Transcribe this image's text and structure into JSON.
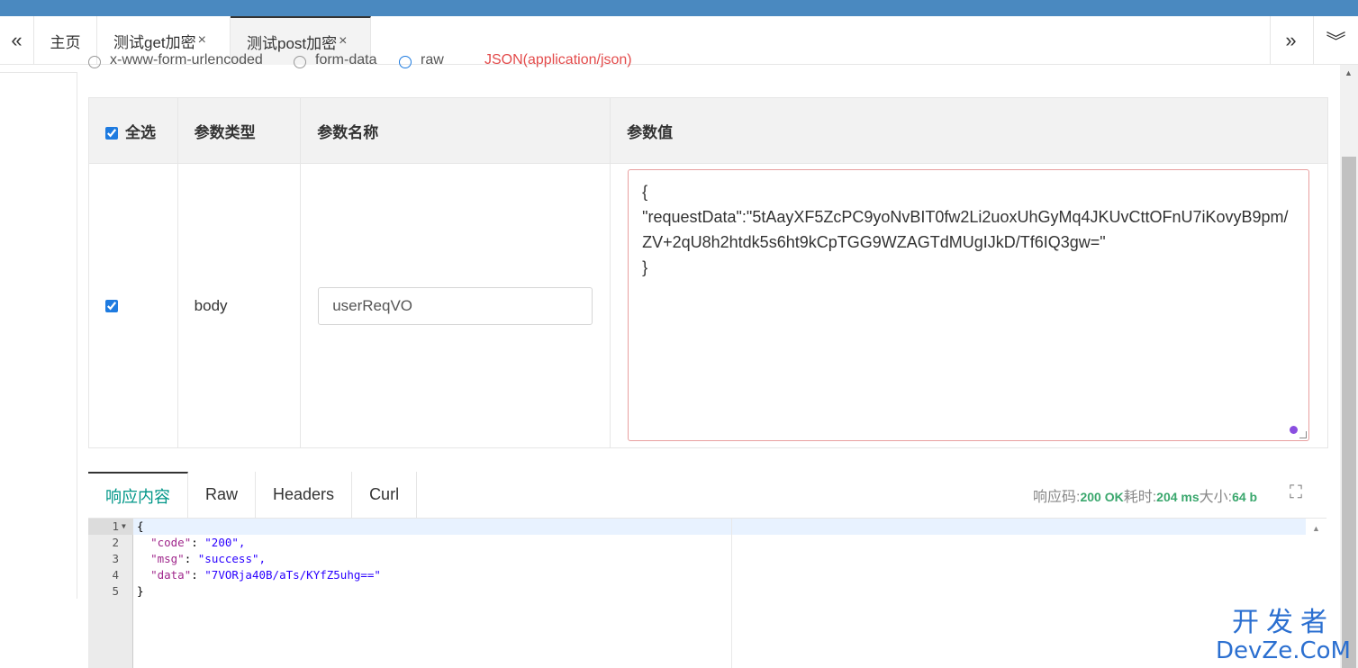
{
  "tabbar": {
    "prev_glyph": "«",
    "next_glyph": "»",
    "menu_glyph": "︾",
    "tabs": [
      {
        "label": "主页"
      },
      {
        "label": "测试get加密",
        "close": "×"
      },
      {
        "label": "测试post加密",
        "close": "×"
      }
    ]
  },
  "body_type_row": {
    "option1": "x-www-form-urlencoded",
    "option2": "form-data",
    "option3": "raw",
    "format": "JSON(application/json)"
  },
  "params_table": {
    "headers": {
      "select_all": "全选",
      "type": "参数类型",
      "name": "参数名称",
      "value": "参数值"
    },
    "row": {
      "type": "body",
      "name": "userReqVO",
      "value": "{\n\"requestData\":\"5tAayXF5ZcPC9yoNvBIT0fw2Li2uoxUhGyMq4JKUvCttOFnU7iKovyB9pm/ZV+2qU8h2htdk5s6ht9kCpTGG9WZAGTdMUgIJkD/Tf6IQ3gw=\"\n}"
    }
  },
  "response": {
    "tabs": [
      "响应内容",
      "Raw",
      "Headers",
      "Curl"
    ],
    "status_code_label": "响应码:",
    "status_code": "200 OK",
    "time_label": "耗时:",
    "time": "204 ms",
    "size_label": "大小:",
    "size": "64 b",
    "code_lines": [
      {
        "n": "1",
        "text": "{"
      },
      {
        "n": "2",
        "key": "\"code\"",
        "val": "\"200\","
      },
      {
        "n": "3",
        "key": "\"msg\"",
        "val": "\"success\","
      },
      {
        "n": "4",
        "key": "\"data\"",
        "val": "\"7VORja40B/aTs/KYfZ5uhg==\""
      },
      {
        "n": "5",
        "text": "}"
      }
    ]
  },
  "watermark": {
    "cn": "开发者",
    "en": "DevZe.CoM"
  }
}
